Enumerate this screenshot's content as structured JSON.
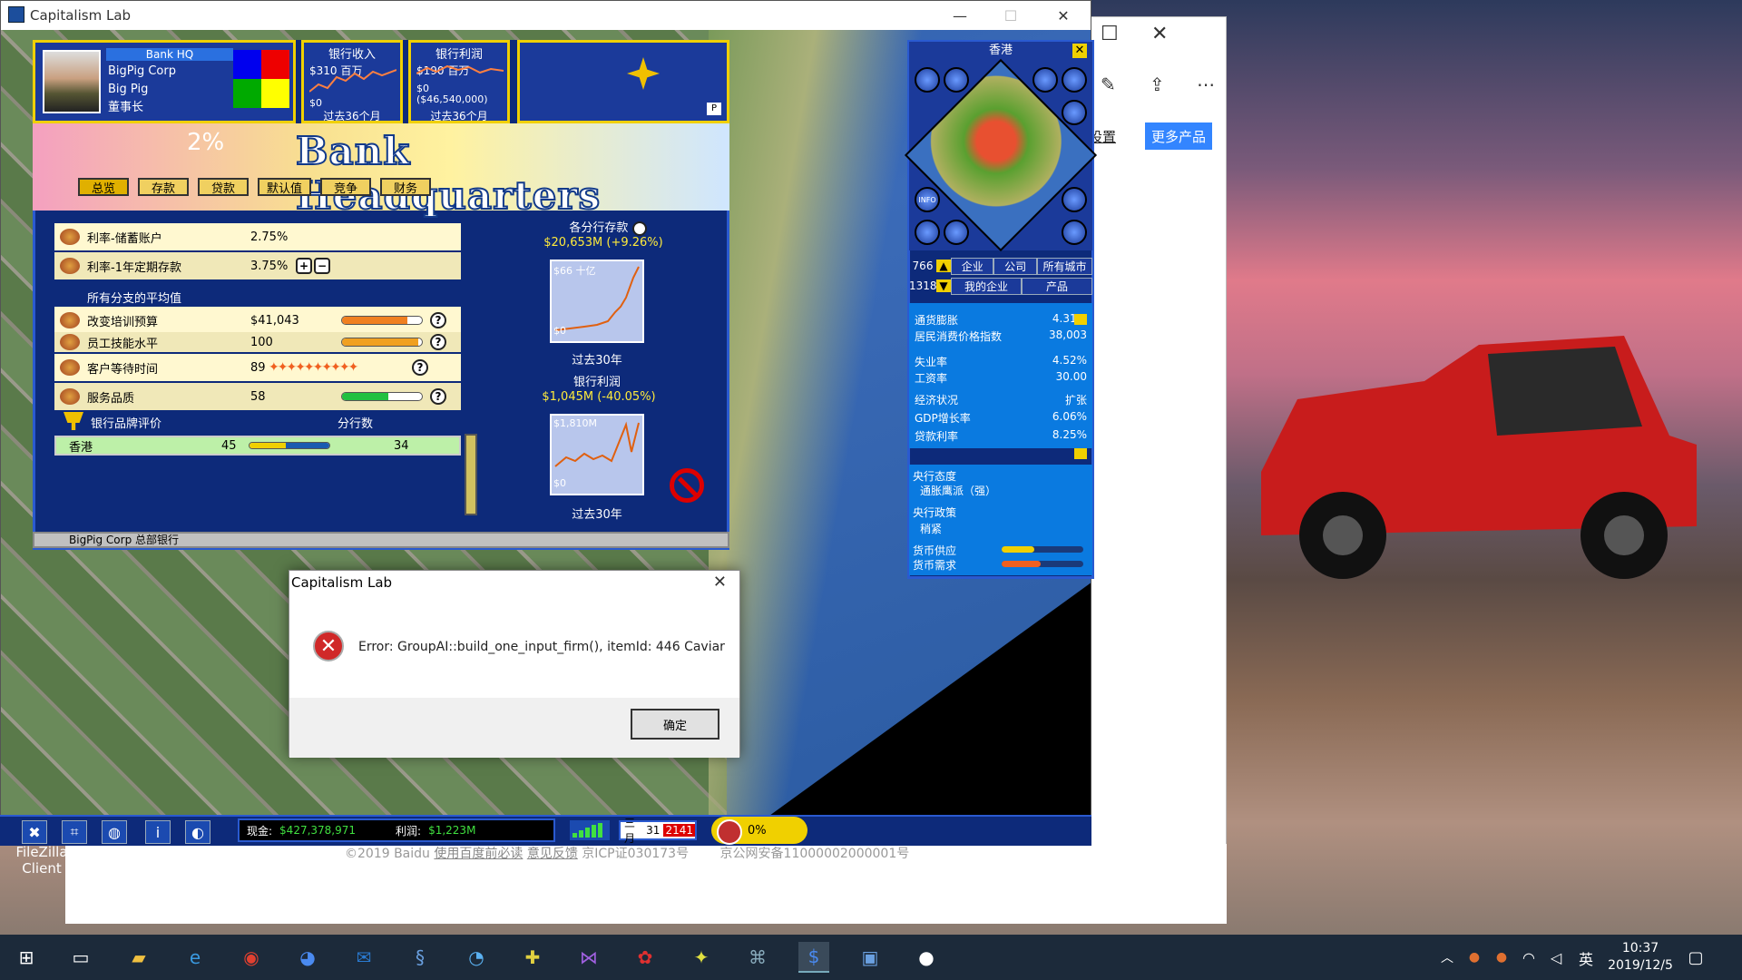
{
  "game_window": {
    "title": "Capitalism Lab",
    "controls": {
      "minimize": "—",
      "maximize": "☐",
      "close": "✕"
    }
  },
  "ceo_panel": {
    "bank_label": "Bank HQ",
    "company": "BigPig Corp",
    "name": "Big Pig",
    "role": "董事长"
  },
  "revenue_chart": {
    "title": "银行收入",
    "top": "$310 百万",
    "bottom": "$0",
    "footer": "过去36个月"
  },
  "profit_chart": {
    "title": "银行利润",
    "top": "$190 百万",
    "bottom_1": "$0",
    "bottom_2": "($46,540,000)",
    "footer": "过去36个月"
  },
  "big_box": {
    "p_label": "P"
  },
  "banner": {
    "title": "Bank Headquarters",
    "percent": "2%"
  },
  "tabs": [
    "总览",
    "存款",
    "贷款",
    "默认值",
    "竞争",
    "财务"
  ],
  "rates": [
    {
      "label": "利率-储蓄账户",
      "value": "2.75%"
    },
    {
      "label": "利率-1年定期存款",
      "value": "3.75%"
    }
  ],
  "avg_title": "所有分支的平均值",
  "averages": [
    {
      "label": "改变培训预算",
      "value": "$41,043",
      "level": 0.82,
      "color": "#f08020"
    },
    {
      "label": "员工技能水平",
      "value": "100",
      "level": 0.95,
      "color": "#f0a020"
    },
    {
      "label": "客户等待时间",
      "value": "89",
      "level": 0.0,
      "color": "#f06020"
    },
    {
      "label": "服务品质",
      "value": "58",
      "level": 0.58,
      "color": "#20c040"
    }
  ],
  "brand": {
    "title": "银行品牌评价",
    "branches_title": "分行数",
    "row": {
      "city": "香港",
      "rating": "45",
      "branches": "34",
      "level": 0.45
    }
  },
  "deposits": {
    "title": "各分行存款",
    "summary": "$20,653M (+9.26%)",
    "chart_top": "$66 十亿",
    "chart_bottom": "$0",
    "footer": "过去30年"
  },
  "bank_profit": {
    "title": "银行利润",
    "summary": "$1,045M (-40.05%)",
    "chart_top": "$1,810M",
    "chart_bottom": "$0",
    "footer": "过去30年"
  },
  "status_line": "BigPig Corp 总部银行",
  "info_panel": {
    "city": "香港",
    "counts": [
      {
        "num": "766",
        "buttons": [
          "企业",
          "公司",
          "所有城市"
        ]
      },
      {
        "num": "1318",
        "buttons": [
          "我的企业",
          "产品"
        ]
      }
    ],
    "stats": [
      {
        "k": "通货膨胀",
        "v": "4.31%",
        "hi": true
      },
      {
        "k": "居民消费价格指数",
        "v": "38,003",
        "hi": false
      },
      {
        "k": "失业率",
        "v": "4.52%",
        "hi": true
      },
      {
        "k": "工资率",
        "v": "30.00",
        "hi": false
      },
      {
        "k": "经济状况",
        "v": "扩张",
        "hi": true
      },
      {
        "k": "GDP增长率",
        "v": "6.06%",
        "hi": true
      },
      {
        "k": "贷款利率",
        "v": "8.25%",
        "hi": true
      }
    ],
    "policy_stance_title": "央行态度",
    "policy_stance": "通胀鹰派（强）",
    "policy_title": "央行政策",
    "policy": "稍紧",
    "money_supply": "货币供应",
    "money_demand": "货币需求",
    "map_info": "INFO"
  },
  "gamebar": {
    "cash_label": "现金:",
    "cash": "$427,378,971",
    "profit_label": "利润:",
    "profit": "$1,223M",
    "month": "三月",
    "day": "31",
    "year": "2141",
    "percent": "0%"
  },
  "dialog": {
    "title": "Capitalism Lab",
    "message": "Error: GroupAI::build_one_input_firm(), itemId: 446 Caviar",
    "ok": "确定",
    "close": "✕"
  },
  "browser": {
    "settings": "设置",
    "more": "更多产品",
    "footer_copy": "©2019 Baidu",
    "footer_link1": "使用百度前必读",
    "footer_link2": "意见反馈",
    "footer_icp": "京ICP证030173号",
    "footer_police": "京公网安备11000002000001号"
  },
  "desktop_icon": {
    "line1": "FileZilla",
    "line2": "Client"
  },
  "taskbar": {
    "ime": "英",
    "time": "10:37",
    "date": "2019/12/5"
  }
}
